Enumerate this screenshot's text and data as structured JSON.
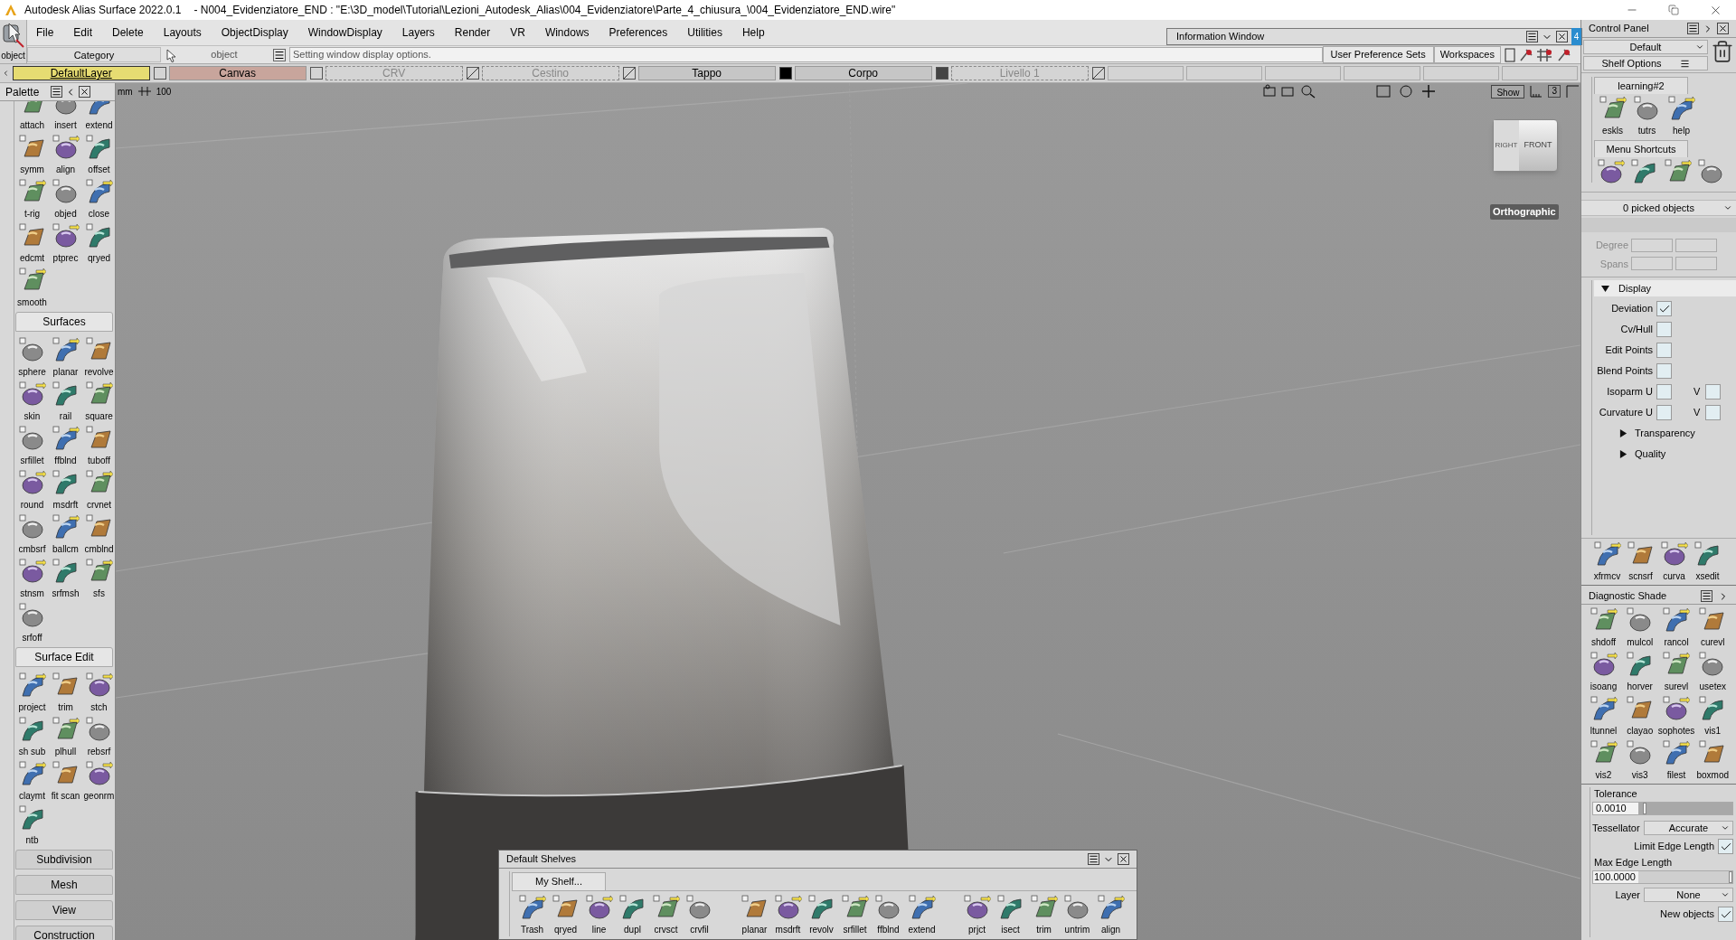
{
  "title_bar": {
    "app": "Autodesk Alias Surface 2022.0.1",
    "document": "- N004_Evidenziatore_END : \"E:\\3D_model\\Tutorial\\Lezioni_Autodesk_Alias\\004_Evidenziatore\\Parte_4_chiusura_\\004_Evidenziatore_END.wire\""
  },
  "object_tool": {
    "label": "object"
  },
  "menu": [
    "File",
    "Edit",
    "Delete",
    "Layouts",
    "ObjectDisplay",
    "WindowDisplay",
    "Layers",
    "Render",
    "VR",
    "Windows",
    "Preferences",
    "Utilities",
    "Help"
  ],
  "category": {
    "label": "Category"
  },
  "pick_mode": {
    "label": "object"
  },
  "status": {
    "message": "Setting window display options."
  },
  "info_window": {
    "title": "Information Window",
    "badge": "4"
  },
  "preference_buttons": [
    "User Preference Sets",
    "Workspaces"
  ],
  "layers": [
    {
      "name": "DefaultLayer",
      "selected": true,
      "visible": true
    },
    {
      "name": "Canvas",
      "selected": false,
      "visible": true,
      "kind": "canvas"
    },
    {
      "name": "CRV",
      "selected": false,
      "visible": false
    },
    {
      "name": "Cestino",
      "selected": false,
      "visible": false
    },
    {
      "name": "Tappo",
      "selected": false,
      "visible": true,
      "color": "#000000"
    },
    {
      "name": "Corpo",
      "selected": false,
      "visible": true,
      "color": "#444444"
    },
    {
      "name": "Livello 1",
      "selected": false,
      "visible": false
    }
  ],
  "palette": {
    "title": "Palette",
    "sections": [
      {
        "tools": [
          "attach",
          "insert",
          "extend",
          "symm",
          "align",
          "offset",
          "t-rig",
          "objed",
          "close",
          "edcmt",
          "ptprec",
          "qryed",
          "smooth"
        ]
      },
      {
        "title": "Surfaces",
        "expanded": true,
        "tools": [
          "sphere",
          "planar",
          "revolve",
          "skin",
          "rail",
          "square",
          "srfillet",
          "ffblnd",
          "tuboff",
          "round",
          "msdrft",
          "crvnet",
          "cmbsrf",
          "ballcm",
          "cmblnd",
          "stnsm",
          "srfmsh",
          "sfs",
          "srfoff"
        ]
      },
      {
        "title": "Surface Edit",
        "expanded": true,
        "tools": [
          "project",
          "trim",
          "stch",
          "sh sub",
          "plhull",
          "rebsrf",
          "claymt",
          "fit scan",
          "geonrm",
          "ntb"
        ]
      },
      {
        "title": "Subdivision",
        "expanded": false
      },
      {
        "title": "Mesh",
        "expanded": false
      },
      {
        "title": "View",
        "expanded": false
      },
      {
        "title": "Construction",
        "expanded": false
      }
    ]
  },
  "viewport": {
    "units": "mm",
    "grid": "100",
    "show_button": "Show",
    "layout_number": "3",
    "viewcube": {
      "right": "RIGHT",
      "front": "FRONT"
    },
    "projection": "Orthographic"
  },
  "control_panel": {
    "title": "Control Panel",
    "preset": "Default",
    "shelf_options": "Shelf Options",
    "shelf_tabs": [
      {
        "label": "learning#2",
        "tools": [
          "eskls",
          "tutrs",
          "help"
        ]
      },
      {
        "label": "Menu Shortcuts",
        "icons": [
          {
            "kind": "grid"
          },
          {
            "kind": "tree"
          },
          {
            "kind": "info"
          },
          {
            "kind": "check"
          }
        ]
      }
    ],
    "picked": "0 picked objects",
    "fields": [
      {
        "label": "Degree",
        "disabled": true
      },
      {
        "label": "Spans",
        "disabled": true
      }
    ],
    "display": {
      "title": "Display",
      "expanded": true,
      "options": [
        {
          "label": "Deviation",
          "checked": true
        },
        {
          "label": "Cv/Hull",
          "checked": false
        },
        {
          "label": "Edit Points",
          "checked": false
        },
        {
          "label": "Blend Points",
          "checked": false
        },
        {
          "label": "Isoparm U",
          "checked": false,
          "v": {
            "label": "V",
            "checked": false
          }
        },
        {
          "label": "Curvature U",
          "checked": false,
          "v": {
            "label": "V",
            "checked": false
          }
        }
      ],
      "subsections": [
        {
          "title": "Transparency",
          "expanded": false
        },
        {
          "title": "Quality",
          "expanded": false
        }
      ]
    },
    "tools": [
      "xfrmcv",
      "scnsrf",
      "curva",
      "xsedit"
    ]
  },
  "diagnostic_shade": {
    "title": "Diagnostic Shade",
    "tools": [
      "shdoff",
      "mulcol",
      "rancol",
      "curevl",
      "isoang",
      "horver",
      "surevl",
      "usetex",
      "ltunnel",
      "clayao",
      "sophotes",
      "vis1",
      "vis2",
      "vis3",
      "filest",
      "boxmod"
    ],
    "tolerance": {
      "label": "Tolerance",
      "value": "0.0010",
      "level": 0.05
    },
    "tessellator": {
      "label": "Tessellator",
      "value": "Accurate"
    },
    "limit_edge": {
      "label": "Limit Edge Length",
      "checked": true
    },
    "max_edge": {
      "label": "Max Edge Length",
      "value": "100.0000",
      "level": 1
    },
    "layer": {
      "label": "Layer",
      "value": "None"
    },
    "new_objects": {
      "label": "New objects",
      "checked": true
    }
  },
  "shelf": {
    "title": "Default Shelves",
    "tab": "My Shelf...",
    "groups": [
      [
        "Trash",
        "qryed",
        "line",
        "dupl",
        "crvsct",
        "crvfil"
      ],
      [
        "planar",
        "msdrft",
        "revolv",
        "srfillet",
        "ffblnd",
        "extend"
      ],
      [
        "prjct",
        "isect",
        "trim",
        "untrim",
        "align"
      ]
    ]
  }
}
